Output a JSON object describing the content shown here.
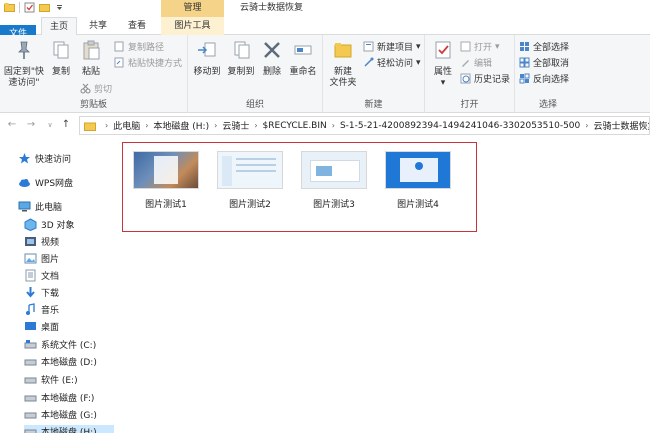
{
  "titlebar": {
    "context_tab": "管理",
    "window_title": "云骑士数据恢复"
  },
  "tabs": {
    "file": "文件",
    "home": "主页",
    "share": "共享",
    "view": "查看",
    "picture_tools": "图片工具"
  },
  "ribbon": {
    "clipboard": {
      "pin_line1": "固定到\"快",
      "pin_line2": "速访问\"",
      "copy": "复制",
      "paste": "粘贴",
      "copy_path": "复制路径",
      "paste_shortcut": "粘贴快捷方式",
      "cut": "剪切",
      "label": "剪贴板"
    },
    "organize": {
      "move_to": "移动到",
      "copy_to": "复制到",
      "delete": "删除",
      "rename": "重命名",
      "label": "组织"
    },
    "new": {
      "new_folder_line1": "新建",
      "new_folder_line2": "文件夹",
      "new_item": "新建项目",
      "easy_access": "轻松访问",
      "label": "新建"
    },
    "open": {
      "properties": "属性",
      "open": "打开",
      "edit": "编辑",
      "history": "历史记录",
      "label": "打开"
    },
    "select": {
      "select_all": "全部选择",
      "select_none": "全部取消",
      "invert": "反向选择",
      "label": "选择"
    }
  },
  "address": {
    "crumbs": [
      "此电脑",
      "本地磁盘 (H:)",
      "云骑士",
      "$RECYCLE.BIN",
      "S-1-5-21-4200892394-1494241046-3302053510-500",
      "云骑士数据恢复"
    ]
  },
  "navpane": {
    "items": [
      "快速访问",
      "WPS网盘",
      "此电脑",
      "3D 对象",
      "视频",
      "图片",
      "文档",
      "下载",
      "音乐",
      "桌面",
      "系统文件 (C:)",
      "本地磁盘 (D:)",
      "软件 (E:)",
      "本地磁盘 (F:)",
      "本地磁盘 (G:)",
      "本地磁盘 (H:)"
    ]
  },
  "files": [
    "图片测试1",
    "图片测试2",
    "图片测试3",
    "图片测试4"
  ],
  "colors": {
    "accent": "#1979ca",
    "context_tab": "#f5d48a",
    "highlight_box": "#c7343a",
    "ribbon_bg": "#f5f6f7"
  }
}
